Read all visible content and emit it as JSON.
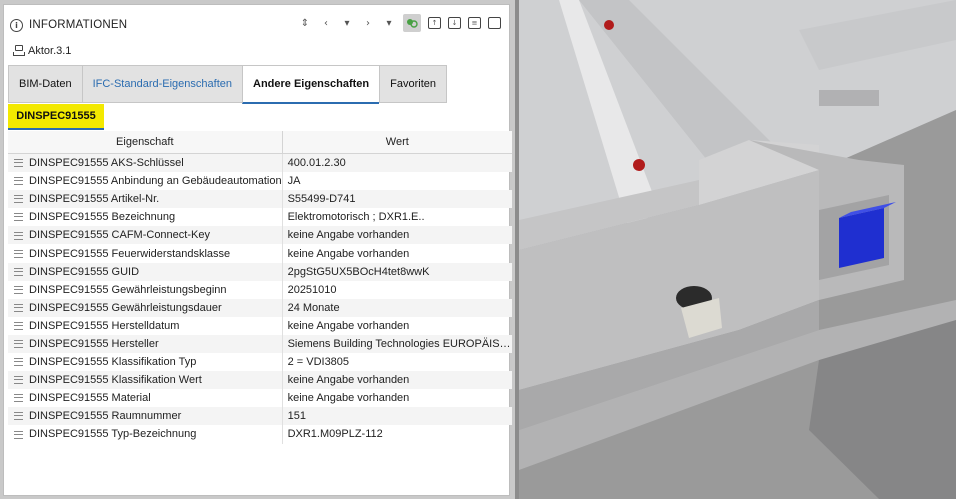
{
  "panel": {
    "title": "INFORMATIONEN",
    "element_name": "Aktor.3.1",
    "toolbar_icons": [
      "sort-icon",
      "chevron-left-icon",
      "dropdown-arrow-icon",
      "chevron-right-icon",
      "dropdown-arrow-icon",
      "link-icon",
      "export-icon-1",
      "export-icon-2",
      "export-icon-3",
      "panel-icon"
    ]
  },
  "tabs": [
    {
      "label": "BIM-Daten"
    },
    {
      "label": "IFC-Standard-Eigenschaften"
    },
    {
      "label": "Andere Eigenschaften"
    },
    {
      "label": "Favoriten"
    }
  ],
  "subtab": {
    "label": "DINSPEC91555"
  },
  "table": {
    "columns": [
      "Eigenschaft",
      "Wert"
    ],
    "rows": [
      {
        "property": "DINSPEC91555 AKS-Schlüssel",
        "value": "400.01.2.30"
      },
      {
        "property": "DINSPEC91555 Anbindung an Gebäudeautomation",
        "value": "JA"
      },
      {
        "property": "DINSPEC91555 Artikel-Nr.",
        "value": "S55499-D741"
      },
      {
        "property": "DINSPEC91555 Bezeichnung",
        "value": "Elektromotorisch ; DXR1.E.."
      },
      {
        "property": "DINSPEC91555 CAFM-Connect-Key",
        "value": "keine Angabe vorhanden"
      },
      {
        "property": "DINSPEC91555 Feuerwiderstandsklasse",
        "value": "keine Angabe vorhanden"
      },
      {
        "property": "DINSPEC91555 GUID",
        "value": "2pgStG5UX5BOcH4tet8wwK"
      },
      {
        "property": "DINSPEC91555 Gewährleistungsbeginn",
        "value": "20251010"
      },
      {
        "property": "DINSPEC91555 Gewährleistungsdauer",
        "value": "24 Monate"
      },
      {
        "property": "DINSPEC91555 Herstelldatum",
        "value": "keine Angabe vorhanden"
      },
      {
        "property": "DINSPEC91555 Hersteller",
        "value": "Siemens Building Technologies EUROPÄISCH..."
      },
      {
        "property": "DINSPEC91555 Klassifikation Typ",
        "value": "2 = VDI3805"
      },
      {
        "property": "DINSPEC91555 Klassifikation Wert",
        "value": "keine Angabe vorhanden"
      },
      {
        "property": "DINSPEC91555 Material",
        "value": "keine Angabe vorhanden"
      },
      {
        "property": "DINSPEC91555 Raumnummer",
        "value": "151"
      },
      {
        "property": "DINSPEC91555 Typ-Bezeichnung",
        "value": "DXR1.M09PLZ-112"
      }
    ]
  },
  "colors": {
    "accent_blue": "#2b6cb0",
    "highlight_yellow": "#f3e900",
    "actuator_blue": "#1f2fd0"
  }
}
